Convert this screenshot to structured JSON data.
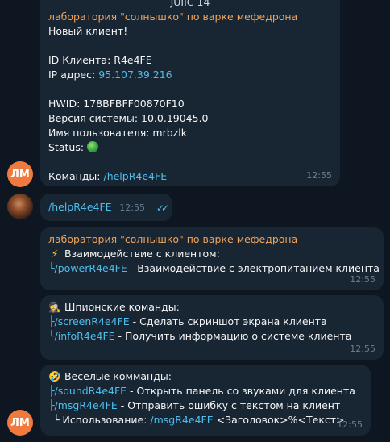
{
  "msg1": {
    "top_fragment": "JUIIC 14",
    "sender": "лаборатория \"солнышко\" по варке мефедрона",
    "line_new_client": "Новый клиент!",
    "id_label": "ID Клиента: ",
    "id_value": "R4e4FE",
    "ip_label": "IP адрес: ",
    "ip_value": "95.107.39.216",
    "hwid": "HWID: 178BFBFF00870F10",
    "os_version": "Версия системы: 10.0.19045.0",
    "username": "Имя пользователя: mrbzlk",
    "status_label": "Status: ",
    "commands_label": "Команды: ",
    "commands_link": "/helpR4e4FE",
    "time": "12:55",
    "avatar": "ЛМ"
  },
  "msg2": {
    "text": "/helpR4e4FE",
    "time": "12:55",
    "read_icon": "double-check-icon"
  },
  "msg3": {
    "sender": "лаборатория \"солнышко\" по варке мефедрона",
    "title": "Взаимодействие с клиентом:",
    "tree_prefix": "└",
    "cmd": "/powerR4e4FE",
    "desc": " - Взаимодействие с электропитанием клиента",
    "time": "12:55"
  },
  "msg4": {
    "title": "Шпионские команды:",
    "rows": [
      {
        "prefix": "├",
        "cmd": "/screenR4e4FE",
        "desc": " - Сделать скриншот экрана клиента"
      },
      {
        "prefix": "└",
        "cmd": "/infoR4e4FE",
        "desc": " - Получить информацию о системе клиента"
      }
    ],
    "time": "12:55"
  },
  "msg5": {
    "title": "Веселые комманды:",
    "rows": [
      {
        "prefix": "├",
        "cmd": "/soundR4e4FE",
        "desc": " - Открыть панель со звуками для клиента"
      },
      {
        "prefix": "├",
        "cmd": "/msgR4e4FE",
        "desc": " - Отправить ошибку с текстом на клиент"
      }
    ],
    "usage_prefix": "└ Использование: ",
    "usage_cmd": "/msgR4e4FE",
    "usage_args": " <Заголовок>%<Текст>",
    "time": "12:55",
    "avatar": "ЛМ"
  }
}
